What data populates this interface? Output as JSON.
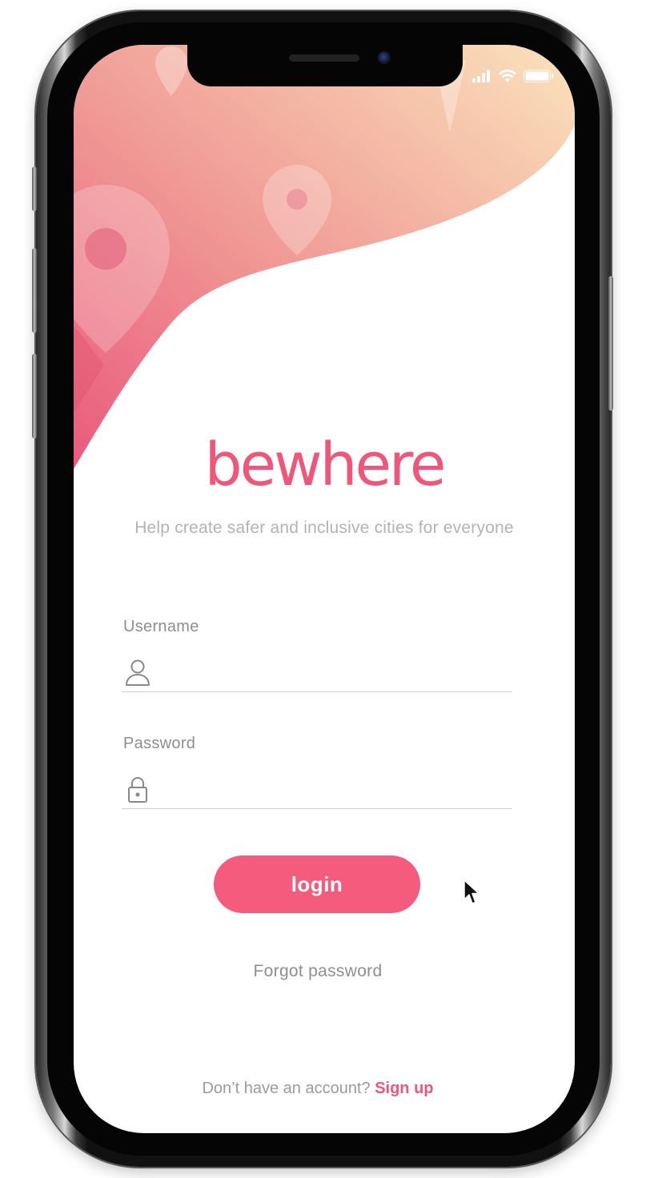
{
  "app": {
    "logo_text": "bewhere",
    "tagline": "Help create safer and inclusive cities for everyone"
  },
  "form": {
    "username_label": "Username",
    "username_value": "",
    "password_label": "Password",
    "password_value": "",
    "login_label": "login",
    "forgot_label": "Forgot password"
  },
  "footer": {
    "prompt": "Don’t have an account?",
    "signup_label": "Sign up"
  },
  "icons": {
    "username": "user-icon",
    "password": "lock-icon",
    "status": [
      "signal-icon",
      "wifi-icon",
      "battery-icon"
    ]
  },
  "colors": {
    "accent": "#f45b7d",
    "gradient_top": "#f7d6b8",
    "gradient_bottom": "#ec5f80",
    "frame": "#111111"
  }
}
